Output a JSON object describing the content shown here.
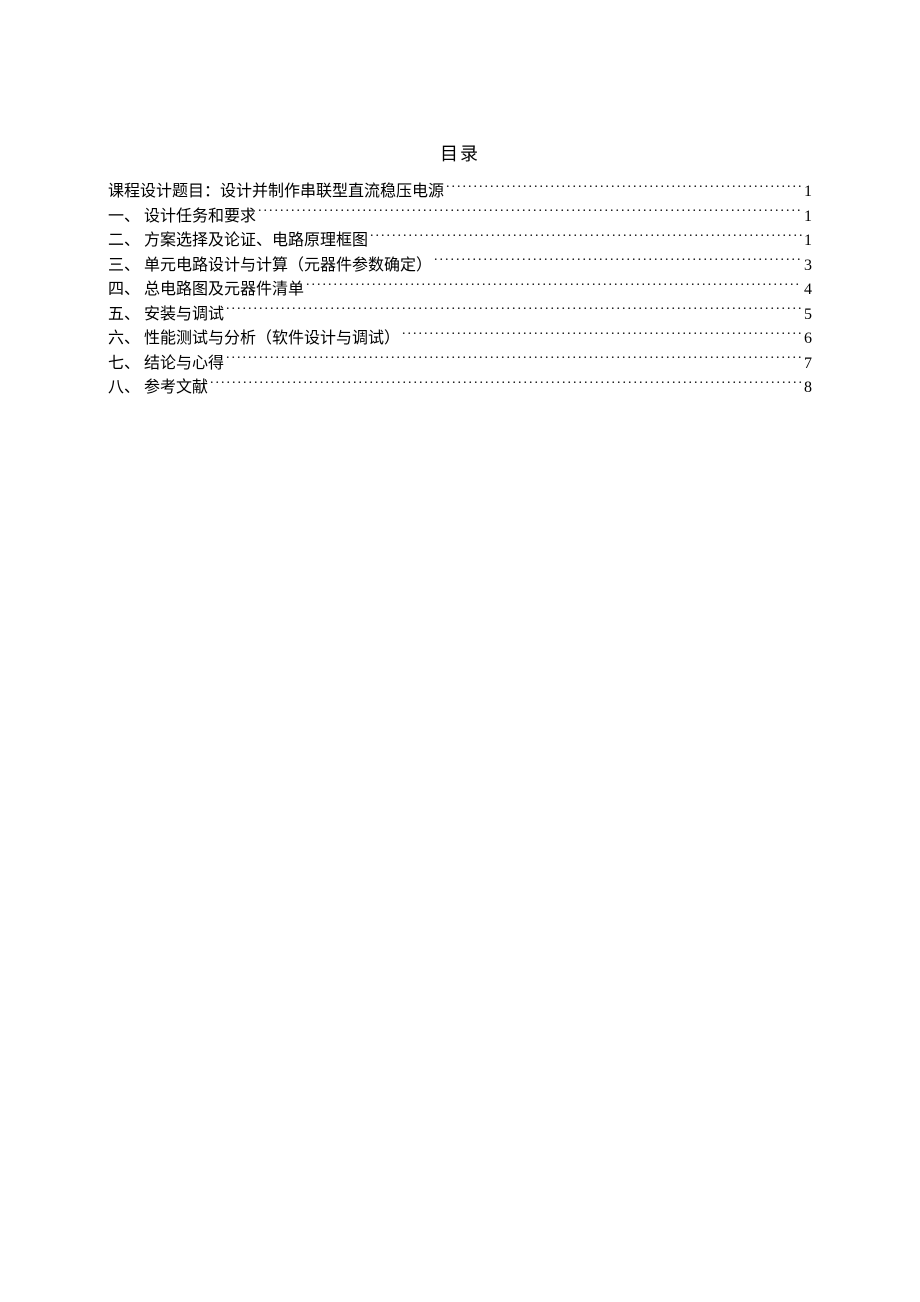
{
  "title": "目录",
  "toc": [
    {
      "label": "课程设计题目：设计并制作串联型直流稳压电源",
      "page": "1"
    },
    {
      "label": "一、 设计任务和要求",
      "page": "1"
    },
    {
      "label": "二、 方案选择及论证、电路原理框图",
      "page": "1"
    },
    {
      "label": "三、 单元电路设计与计算（元器件参数确定）",
      "page": "3"
    },
    {
      "label": "四、 总电路图及元器件清单",
      "page": "4"
    },
    {
      "label": "五、 安装与调试",
      "page": "5"
    },
    {
      "label": "六、 性能测试与分析（软件设计与调试）",
      "page": "6"
    },
    {
      "label": "七、 结论与心得",
      "page": "7"
    },
    {
      "label": "八、 参考文献",
      "page": "8"
    }
  ]
}
